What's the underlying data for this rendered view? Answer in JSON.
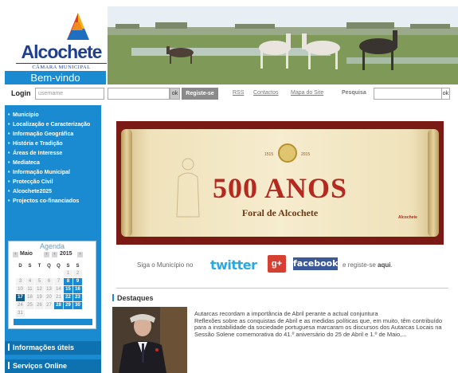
{
  "brand": {
    "name": "Alcochete",
    "subtitle": "CÂMARA MUNICIPAL",
    "welcome": "Bem-vindo"
  },
  "login": {
    "label": "Login",
    "username_placeholder": "username",
    "ok_label": "ok",
    "register_label": "Registe-se"
  },
  "top_links": [
    "RSS",
    "Contactos",
    "Mapa do Site"
  ],
  "search": {
    "label": "Pesquisa",
    "ok_label": "ok"
  },
  "nav": [
    "Município",
    "Localização e Caracterização",
    "Informação Geográfica",
    "História e Tradição",
    "Áreas de Interesse",
    "Mediateca",
    "Informação Municipal",
    "Protecção Civil",
    "Alcochete2025",
    "Projectos co-financiados"
  ],
  "agenda": {
    "title": "Agenda",
    "month": "Maio",
    "year": "2015",
    "weekdays": [
      "D",
      "S",
      "T",
      "Q",
      "Q",
      "S",
      "S"
    ],
    "weeks": [
      [
        "",
        "",
        "",
        "",
        "",
        "1",
        "2"
      ],
      [
        "3",
        "4",
        "5",
        "6",
        "7",
        "8",
        "9"
      ],
      [
        "10",
        "11",
        "12",
        "13",
        "14",
        "15",
        "16"
      ],
      [
        "17",
        "18",
        "19",
        "20",
        "21",
        "22",
        "23"
      ],
      [
        "24",
        "25",
        "26",
        "27",
        "28",
        "29",
        "30"
      ],
      [
        "31",
        "",
        "",
        "",
        "",
        "",
        ""
      ]
    ],
    "highlighted_days": [
      "8",
      "9",
      "15",
      "16",
      "22",
      "23",
      "28",
      "29",
      "30"
    ],
    "current_day": "17"
  },
  "side_sections": [
    "Informações úteis",
    "Serviços Online"
  ],
  "poster": {
    "title": "500 ANOS",
    "subtitle": "Foral de Alcochete",
    "year_left": "1515",
    "year_right": "2015",
    "logo": "Alcochete"
  },
  "social": {
    "prefix": "Siga o Município no",
    "twitter": "twitter",
    "gplus": "g+",
    "facebook": "facebook",
    "suffix_pre": "e registe-se",
    "suffix_link": "aqui",
    "suffix_end": "."
  },
  "destaques": {
    "title": "Destaques",
    "headline": "Autarcas recordam a importância de Abril perante a actual conjuntura",
    "body": "Reflexões sobre as conquistas de Abril e as medidas políticas que, em muito, têm contribuído para a instabilidade da sociedade portuguesa marcaram os discursos dos Autarcas Locais na Sessão Solene comemorativa do 41.º aniversário do 25 de Abril e 1.º de Maio,..."
  },
  "colors": {
    "accent": "#1a8bd0",
    "accent_dark": "#0f72b0",
    "poster_red": "#b42a20",
    "poster_border": "#7b1a14"
  }
}
